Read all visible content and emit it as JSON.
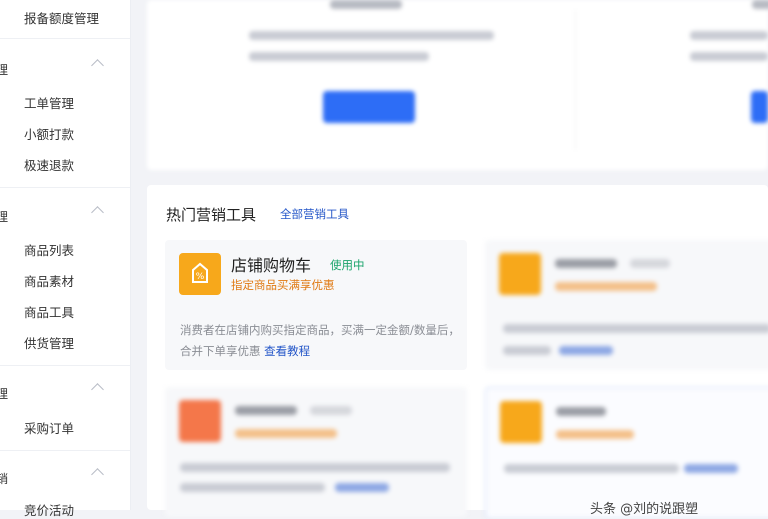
{
  "sidebar": {
    "groups": [
      {
        "mark": "理",
        "items": [
          "工单管理",
          "小额打款",
          "极速退款"
        ]
      },
      {
        "mark": "理",
        "items": [
          "商品列表",
          "商品素材",
          "商品工具",
          "供货管理"
        ]
      },
      {
        "mark": "理",
        "items": [
          "采购订单"
        ]
      },
      {
        "mark": "销",
        "items": [
          "竞价活动"
        ]
      }
    ],
    "top_item": "报备额度管理"
  },
  "tools": {
    "title": "热门营销工具",
    "all_link": "全部营销工具",
    "featured": {
      "name": "店铺购物车",
      "badge": "使用中",
      "subtitle": "指定商品买满享优惠",
      "desc": "消费者在店铺内购买指定商品，买满一定金额/数量后，合并下单享优惠",
      "more": "查看教程",
      "icon": "cart-icon",
      "icon_color": "#f7a81b"
    }
  },
  "watermark": "头条 @刘的说跟塑",
  "colors": {
    "accent": "#2d6df6",
    "link": "#2456c8",
    "badge": "#1aa36b",
    "orange": "#f7a81b"
  }
}
